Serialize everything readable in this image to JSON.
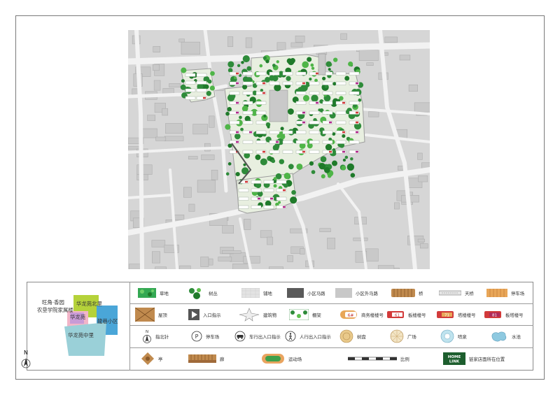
{
  "location_inset": {
    "labels": [
      "旺角·香园",
      "农垦学院家属楼",
      "华龙苑北里",
      "华龙苑",
      "龍巷小区",
      "华龙苑中里"
    ],
    "colors": [
      "#f2b5c8",
      "#b5d23a",
      "#4aa6d8",
      "#9ad0d8",
      "#c89bd6"
    ]
  },
  "north_label": "N",
  "legend": {
    "row1": [
      "草地",
      "树丛",
      "铺地",
      "小区马路",
      "小区外马路",
      "桥",
      "天桥",
      "停车场"
    ],
    "row2": [
      "屋顶",
      "入口指示",
      "建筑物",
      "棚架",
      "商务楼楼号",
      "板楼楼号",
      "塔楼楼号",
      "板塔楼号"
    ],
    "row3": [
      "指北针",
      "停车场",
      "车行出入口指示",
      "人行出入口指示",
      "树盘",
      "广场",
      "喷泉",
      "水池"
    ],
    "row4": [
      "亭",
      "廊",
      "运动场",
      "比例",
      "链家店面所在位置"
    ],
    "building_numbers": [
      "6#",
      "61",
      "71",
      "81"
    ],
    "brand_logo": [
      "HOME",
      "LINK"
    ]
  },
  "colors": {
    "grass": "#34a853",
    "grass_dark": "#1f7a2a",
    "building": "#ffffff",
    "road": "#ebebeb",
    "dark_road": "#5a5a5a",
    "roof": "#c08a4e",
    "parking": "#e8a658",
    "water": "#8ec9e0"
  }
}
